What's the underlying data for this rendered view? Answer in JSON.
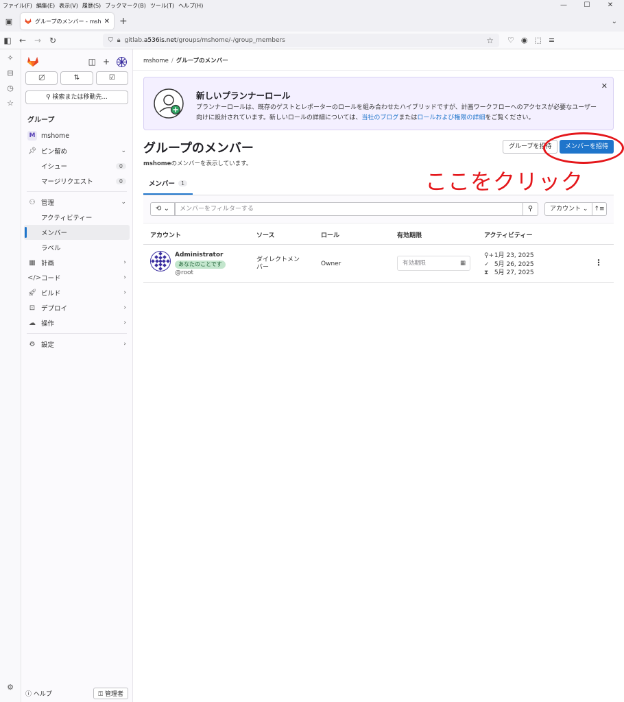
{
  "browser": {
    "menu": [
      "ファイル(F)",
      "編集(E)",
      "表示(V)",
      "履歴(S)",
      "ブックマーク(B)",
      "ツール(T)",
      "ヘルプ(H)"
    ],
    "tab_title": "グループのメンバー - mshome · GitL",
    "url_prefix": "gitlab.",
    "url_host": "a536is.net",
    "url_path": "/groups/mshome/-/group_members"
  },
  "sidebar": {
    "search_label": "検索または移動先...",
    "section_title": "グループ",
    "group_name": "mshome",
    "group_initial": "M",
    "pinned": "ピン留め",
    "issues": "イシュー",
    "issues_count": "0",
    "merge_requests": "マージリクエスト",
    "mr_count": "0",
    "manage": "管理",
    "activity": "アクティビティー",
    "members": "メンバー",
    "labels": "ラベル",
    "plan": "計画",
    "code": "コード",
    "build": "ビルド",
    "deploy": "デプロイ",
    "operate": "操作",
    "settings": "設定",
    "help": "ヘルプ",
    "admin": "管理者"
  },
  "breadcrumb": {
    "group": "mshome",
    "separator": "/",
    "current": "グループのメンバー"
  },
  "banner": {
    "title": "新しいプランナーロール",
    "body_1": "プランナーロールは、既存のゲストとレポーターのロールを組み合わせたハイブリッドですが、計画ワークフローへのアクセスが必要なユーザー向けに設計されています。新しいロールの詳細については、",
    "link_blog": "当社のブログ",
    "body_2": "または",
    "link_docs": "ロールおよび権限の詳細",
    "body_3": "をご覧ください。"
  },
  "page": {
    "title": "グループのメンバー",
    "subtitle_group": "mshome",
    "subtitle_rest": "のメンバーを表示しています。",
    "invite_group_button": "グループを招待",
    "invite_member_button": "メンバーを招待",
    "annotation": "ここをクリック"
  },
  "tabs": [
    {
      "label": "メンバー",
      "count": "1"
    }
  ],
  "filter": {
    "placeholder": "メンバーをフィルターする",
    "sort_label": "アカウント"
  },
  "table": {
    "headers": [
      "アカウント",
      "ソース",
      "ロール",
      "有効期限",
      "アクティビティー"
    ],
    "rows": [
      {
        "name": "Administrator",
        "badge": "あなたのことです",
        "handle": "@root",
        "source": "ダイレクトメンバー",
        "role": "Owner",
        "expiry_placeholder": "有効期限",
        "activity": [
          "1月 23, 2025",
          "5月 26, 2025",
          "5月 27, 2025"
        ]
      }
    ]
  },
  "colors": {
    "primary": "#1f75cb",
    "annotation_red": "#e4171b",
    "banner_bg": "#f4f0ff"
  }
}
